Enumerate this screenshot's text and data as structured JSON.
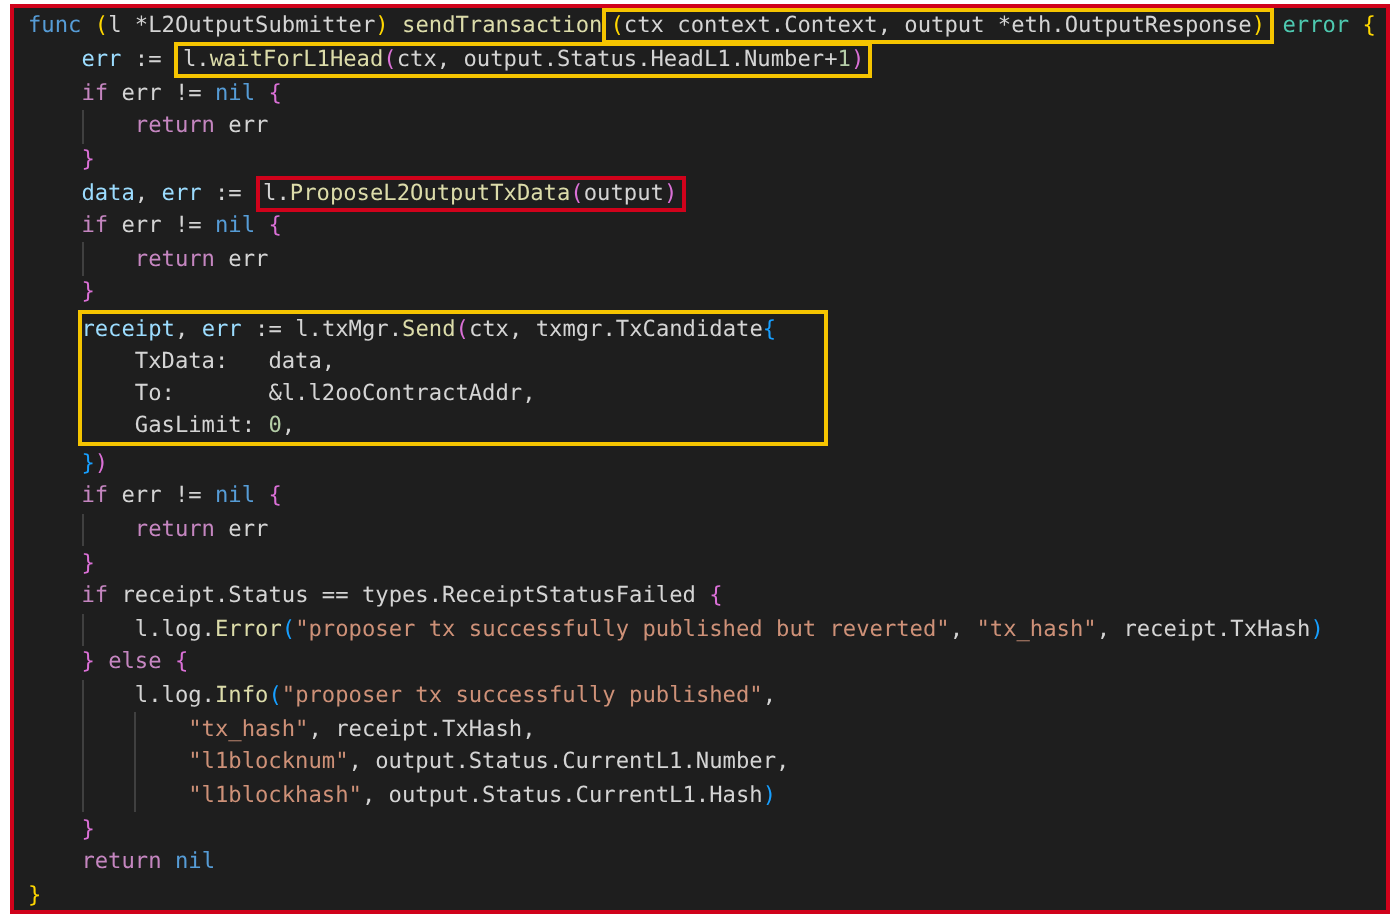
{
  "code": {
    "lines": [
      {
        "tokens": [
          {
            "kind": "kw",
            "text": "func"
          },
          {
            "kind": "b1",
            "text": " ("
          },
          {
            "kind": "plain",
            "text": "l *L2OutputSubmitter"
          },
          {
            "kind": "b1",
            "text": ")"
          },
          {
            "kind": "fn",
            "text": " sendTransaction"
          },
          {
            "kind": "box",
            "color": "#f5c400",
            "tokens": [
              {
                "kind": "b1",
                "text": "("
              },
              {
                "kind": "plain",
                "text": "ctx context.Context, output *eth.OutputResponse"
              },
              {
                "kind": "b1",
                "text": ")"
              }
            ]
          },
          {
            "kind": "type",
            "text": " error"
          },
          {
            "kind": "b1",
            "text": " {"
          }
        ],
        "children": [
          {
            "tokens": [
              {
                "kind": "var",
                "text": "err"
              },
              {
                "kind": "plain",
                "text": " := "
              },
              {
                "kind": "box",
                "color": "#f5c400",
                "tokens": [
                  {
                    "kind": "plain",
                    "text": "l."
                  },
                  {
                    "kind": "fn",
                    "text": "waitForL1Head"
                  },
                  {
                    "kind": "b2",
                    "text": "("
                  },
                  {
                    "kind": "plain",
                    "text": "ctx, output.Status.HeadL1.Number+"
                  },
                  {
                    "kind": "num",
                    "text": "1"
                  },
                  {
                    "kind": "b2",
                    "text": ")"
                  }
                ]
              }
            ]
          },
          {
            "tokens": [
              {
                "kind": "ctrl",
                "text": "if"
              },
              {
                "kind": "plain",
                "text": " err != "
              },
              {
                "kind": "kw",
                "text": "nil"
              },
              {
                "kind": "b2",
                "text": " {"
              }
            ],
            "children": [
              {
                "tokens": [
                  {
                    "kind": "ctrl",
                    "text": "return"
                  },
                  {
                    "kind": "plain",
                    "text": " err"
                  }
                ]
              }
            ]
          },
          {
            "tokens": [
              {
                "kind": "b2",
                "text": "}"
              }
            ]
          },
          {
            "tokens": [
              {
                "kind": "var",
                "text": "data"
              },
              {
                "kind": "plain",
                "text": ", "
              },
              {
                "kind": "var",
                "text": "err"
              },
              {
                "kind": "plain",
                "text": " := "
              },
              {
                "kind": "box",
                "color": "#d0021b",
                "tokens": [
                  {
                    "kind": "plain",
                    "text": "l."
                  },
                  {
                    "kind": "fn",
                    "text": "ProposeL2OutputTxData"
                  },
                  {
                    "kind": "b2",
                    "text": "("
                  },
                  {
                    "kind": "plain",
                    "text": "output"
                  },
                  {
                    "kind": "b2",
                    "text": ")"
                  }
                ]
              }
            ]
          },
          {
            "tokens": [
              {
                "kind": "ctrl",
                "text": "if"
              },
              {
                "kind": "plain",
                "text": " err != "
              },
              {
                "kind": "kw",
                "text": "nil"
              },
              {
                "kind": "b2",
                "text": " {"
              }
            ],
            "children": [
              {
                "tokens": [
                  {
                    "kind": "ctrl",
                    "text": "return"
                  },
                  {
                    "kind": "plain",
                    "text": " err"
                  }
                ]
              }
            ]
          },
          {
            "tokens": [
              {
                "kind": "b2",
                "text": "}"
              }
            ]
          },
          {
            "kind": "block",
            "color": "#f5c400",
            "lines": [
              {
                "tokens": [
                  {
                    "kind": "var",
                    "text": "receipt"
                  },
                  {
                    "kind": "plain",
                    "text": ", "
                  },
                  {
                    "kind": "var",
                    "text": "err"
                  },
                  {
                    "kind": "plain",
                    "text": " := l.txMgr."
                  },
                  {
                    "kind": "fn",
                    "text": "Send"
                  },
                  {
                    "kind": "b2",
                    "text": "("
                  },
                  {
                    "kind": "plain",
                    "text": "ctx, txmgr.TxCandidate"
                  },
                  {
                    "kind": "b3",
                    "text": "{"
                  }
                ],
                "children": [
                  {
                    "tokens": [
                      {
                        "kind": "plain",
                        "text": "TxData:   data,"
                      }
                    ]
                  },
                  {
                    "tokens": [
                      {
                        "kind": "plain",
                        "text": "To:       &l.l2ooContractAddr,"
                      }
                    ]
                  },
                  {
                    "tokens": [
                      {
                        "kind": "plain",
                        "text": "GasLimit: "
                      },
                      {
                        "kind": "num",
                        "text": "0"
                      },
                      {
                        "kind": "plain",
                        "text": ","
                      }
                    ]
                  }
                ]
              }
            ]
          },
          {
            "tokens": [
              {
                "kind": "b3",
                "text": "}"
              },
              {
                "kind": "b2",
                "text": ")"
              }
            ]
          },
          {
            "tokens": [
              {
                "kind": "ctrl",
                "text": "if"
              },
              {
                "kind": "plain",
                "text": " err != "
              },
              {
                "kind": "kw",
                "text": "nil"
              },
              {
                "kind": "b2",
                "text": " {"
              }
            ],
            "children": [
              {
                "tokens": [
                  {
                    "kind": "ctrl",
                    "text": "return"
                  },
                  {
                    "kind": "plain",
                    "text": " err"
                  }
                ]
              }
            ]
          },
          {
            "tokens": [
              {
                "kind": "b2",
                "text": "}"
              }
            ]
          },
          {
            "tokens": [
              {
                "kind": "ctrl",
                "text": "if"
              },
              {
                "kind": "plain",
                "text": " receipt.Status == types.ReceiptStatusFailed "
              },
              {
                "kind": "b2",
                "text": "{"
              }
            ],
            "children": [
              {
                "tokens": [
                  {
                    "kind": "plain",
                    "text": "l.log."
                  },
                  {
                    "kind": "fn",
                    "text": "Error"
                  },
                  {
                    "kind": "b3",
                    "text": "("
                  },
                  {
                    "kind": "str",
                    "text": "\"proposer tx successfully published but reverted\""
                  },
                  {
                    "kind": "plain",
                    "text": ", "
                  },
                  {
                    "kind": "str",
                    "text": "\"tx_hash\""
                  },
                  {
                    "kind": "plain",
                    "text": ", receipt.TxHash"
                  },
                  {
                    "kind": "b3",
                    "text": ")"
                  }
                ]
              }
            ]
          },
          {
            "tokens": [
              {
                "kind": "b2",
                "text": "}"
              },
              {
                "kind": "ctrl",
                "text": " else"
              },
              {
                "kind": "b2",
                "text": " {"
              }
            ],
            "children": [
              {
                "tokens": [
                  {
                    "kind": "plain",
                    "text": "l.log."
                  },
                  {
                    "kind": "fn",
                    "text": "Info"
                  },
                  {
                    "kind": "b3",
                    "text": "("
                  },
                  {
                    "kind": "str",
                    "text": "\"proposer tx successfully published\""
                  },
                  {
                    "kind": "plain",
                    "text": ","
                  }
                ],
                "children": [
                  {
                    "tokens": [
                      {
                        "kind": "str",
                        "text": "\"tx_hash\""
                      },
                      {
                        "kind": "plain",
                        "text": ", receipt.TxHash,"
                      }
                    ]
                  },
                  {
                    "tokens": [
                      {
                        "kind": "str",
                        "text": "\"l1blocknum\""
                      },
                      {
                        "kind": "plain",
                        "text": ", output.Status.CurrentL1.Number,"
                      }
                    ]
                  },
                  {
                    "tokens": [
                      {
                        "kind": "str",
                        "text": "\"l1blockhash\""
                      },
                      {
                        "kind": "plain",
                        "text": ", output.Status.CurrentL1.Hash"
                      },
                      {
                        "kind": "b3",
                        "text": ")"
                      }
                    ]
                  }
                ]
              }
            ]
          },
          {
            "tokens": [
              {
                "kind": "b2",
                "text": "}"
              }
            ]
          },
          {
            "tokens": [
              {
                "kind": "ctrl",
                "text": "return"
              },
              {
                "kind": "kw",
                "text": " nil"
              }
            ]
          }
        ]
      },
      {
        "tokens": [
          {
            "kind": "b1",
            "text": "}"
          }
        ]
      }
    ]
  }
}
